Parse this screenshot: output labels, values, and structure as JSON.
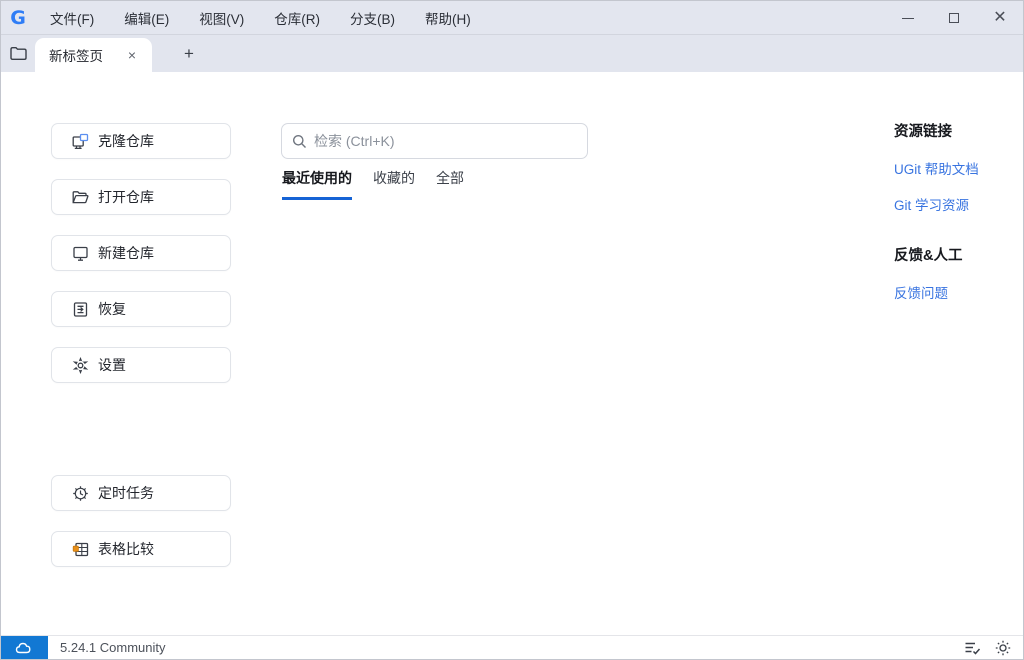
{
  "titlebar": {
    "logo": "G",
    "menu": [
      "文件(F)",
      "编辑(E)",
      "视图(V)",
      "仓库(R)",
      "分支(B)",
      "帮助(H)"
    ],
    "window_controls": [
      {
        "name": "minimize"
      },
      {
        "name": "maximize"
      },
      {
        "name": "close"
      }
    ]
  },
  "tabbar": {
    "folder_icon": "folder-icon",
    "active_tab": {
      "label": "新标签页",
      "close_glyph": "×"
    },
    "new_tab_glyph": "+"
  },
  "sidebar": {
    "buttons": [
      {
        "label": "克隆仓库",
        "icon": "clone-repo-icon"
      },
      {
        "label": "打开仓库",
        "icon": "open-folder-icon"
      },
      {
        "label": "新建仓库",
        "icon": "new-repo-icon"
      },
      {
        "label": "恢复",
        "icon": "restore-icon"
      },
      {
        "label": "设置",
        "icon": "gear-icon"
      },
      {
        "label": "定时任务",
        "icon": "scheduled-task-icon"
      },
      {
        "label": "表格比较",
        "icon": "table-compare-icon"
      }
    ]
  },
  "main": {
    "search": {
      "placeholder": "检索 (Ctrl+K)",
      "icon": "search-icon"
    },
    "tabs": [
      {
        "label": "最近使用的",
        "active": true
      },
      {
        "label": "收藏的",
        "active": false
      },
      {
        "label": "全部",
        "active": false
      }
    ]
  },
  "right_panel": {
    "sections": [
      {
        "title": "资源链接",
        "links": [
          "UGit 帮助文档",
          "Git 学习资源"
        ]
      },
      {
        "title": "反馈&人工",
        "links": [
          "反馈问题"
        ]
      }
    ]
  },
  "statusbar": {
    "cloud_icon": "cloud-icon",
    "version": "5.24.1 Community",
    "icons": [
      "task-list-icon",
      "theme-light-icon"
    ]
  },
  "colors": {
    "accent_blue": "#1563d5",
    "link_blue": "#3974e0",
    "logo_blue": "#2f7df6",
    "status_box_blue": "#1278d3",
    "chrome_bg": "#e3e6ef"
  }
}
